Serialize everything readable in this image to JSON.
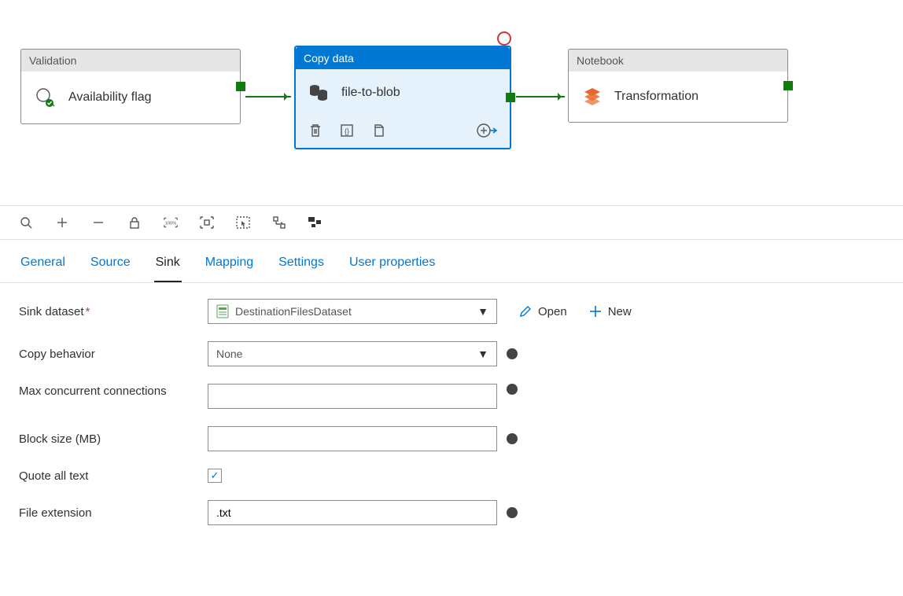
{
  "pipeline": {
    "nodes": {
      "validation": {
        "type": "Validation",
        "title": "Availability flag"
      },
      "copy": {
        "type": "Copy data",
        "title": "file-to-blob"
      },
      "notebook": {
        "type": "Notebook",
        "title": "Transformation"
      }
    }
  },
  "tabs": {
    "general": "General",
    "source": "Source",
    "sink": "Sink",
    "mapping": "Mapping",
    "settings": "Settings",
    "userprops": "User properties"
  },
  "form": {
    "sink_dataset_label": "Sink dataset",
    "sink_dataset_value": "DestinationFilesDataset",
    "open_label": "Open",
    "new_label": "New",
    "copy_behavior_label": "Copy behavior",
    "copy_behavior_value": "None",
    "max_conn_label": "Max concurrent connections",
    "max_conn_value": "",
    "block_size_label": "Block size (MB)",
    "block_size_value": "",
    "quote_all_label": "Quote all text",
    "quote_all_checked": true,
    "file_ext_label": "File extension",
    "file_ext_value": ".txt"
  }
}
